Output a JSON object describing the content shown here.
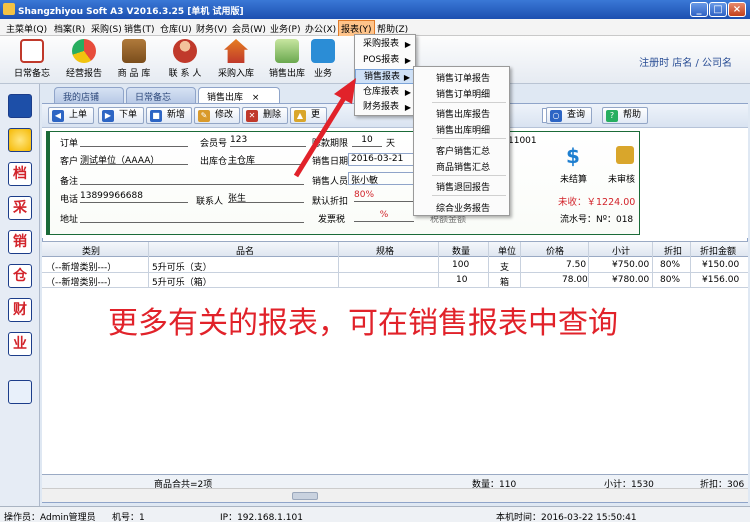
{
  "titlebar": {
    "title": "Shangzhiyou Soft A3 V2016.3.25 [单机 试用版]",
    "min": "_",
    "max": "□",
    "close": "×"
  },
  "menubar": {
    "items": [
      "主菜单(Q)",
      "档案(R)",
      "采购(S)",
      "销售(T)",
      "仓库(U)",
      "财务(V)",
      "会员(W)",
      "业务(P)",
      "办公(X)",
      "报表(Y)",
      "帮助(Z)"
    ]
  },
  "toolbar": {
    "items": [
      "日常备忘",
      "经营报告",
      "商 品 库",
      "联 系 人",
      "采购入库",
      "销售出库",
      "业务"
    ],
    "store_info": "注册时 店名 / 公司名"
  },
  "leftbar": {
    "items": [
      "档",
      "采",
      "销",
      "仓",
      "财",
      "业"
    ]
  },
  "tabs": {
    "items": [
      "我的店铺",
      "日常备忘",
      "销售出库"
    ],
    "close": "×"
  },
  "nav": {
    "prev": "上单",
    "next": "下单",
    "add": "新增",
    "edit": "修改",
    "delete": "删除",
    "more": "更",
    "query": "查询",
    "help": "帮助"
  },
  "form": {
    "order_label": "订单",
    "member_label": "会员号",
    "member_value": "123",
    "credit_label": "赊款期限",
    "credit_value": "10",
    "credit_unit": "天",
    "order_no_tail": "11001",
    "customer_label": "客户",
    "customer_value": "测试单位（AAAA）",
    "warehouse_label": "出库仓",
    "warehouse_value": "主仓库",
    "date_label": "销售日期",
    "date_value": "2016-03-21",
    "note_label": "备注",
    "salesman_label": "销售人员",
    "salesman_value": "张小敏",
    "phone_label": "电话",
    "phone_value": "13899966688",
    "contact_label": "联系人",
    "contact_value": "张生",
    "discount_label": "默认折扣",
    "discount_value": "80%",
    "address_label": "地址",
    "invoice_label": "发票税",
    "invoice_value": "%",
    "amount_label": "税额金额",
    "settle_label": "未结算",
    "audit_label": "未审核",
    "unpaid": "未收：￥1224.00",
    "serial": "流水号：Nº：018"
  },
  "grid": {
    "headers": [
      "类别",
      "品名",
      "规格",
      "数量",
      "单位",
      "价格",
      "小计",
      "折扣",
      "折扣金额"
    ],
    "rows": [
      {
        "category": "（--新增类别---）",
        "name": "5升可乐（支）",
        "spec": "",
        "qty": "100",
        "unit": "支",
        "price": "7.50",
        "subtotal": "¥750.00",
        "discount": "80%",
        "disc_amount": "¥150.00"
      },
      {
        "category": "（--新增类别---）",
        "name": "5升可乐（箱）",
        "spec": "",
        "qty": "10",
        "unit": "箱",
        "price": "78.00",
        "subtotal": "¥780.00",
        "discount": "80%",
        "disc_amount": "¥156.00"
      }
    ],
    "footer": {
      "items_total": "商品合共=2项",
      "qty_total": "数量：110",
      "subtotal": "小计：1530",
      "disc_total": "折扣：306"
    }
  },
  "overlay_text": "更多有关的报表，可在销售报表中查询",
  "report_menu": {
    "items": [
      "采购报表",
      "POS报表",
      "销售报表",
      "仓库报表",
      "财务报表"
    ]
  },
  "sales_submenu": {
    "items": [
      "销售订单报告",
      "销售订单明细",
      "销售出库报告",
      "销售出库明细",
      "客户销售汇总",
      "商品销售汇总",
      "销售退回报告",
      "综合业务报告"
    ]
  },
  "statusbar": {
    "operator": "操作员：Admin管理员",
    "machine": "机号：1",
    "ip": "IP：192.168.1.101",
    "time": "本机时间：2016-03-22 15:50:41"
  },
  "colors": {
    "title_blue": "#1c4fb0",
    "accent_red": "#e1222a",
    "panel_green": "#1b6b38"
  }
}
